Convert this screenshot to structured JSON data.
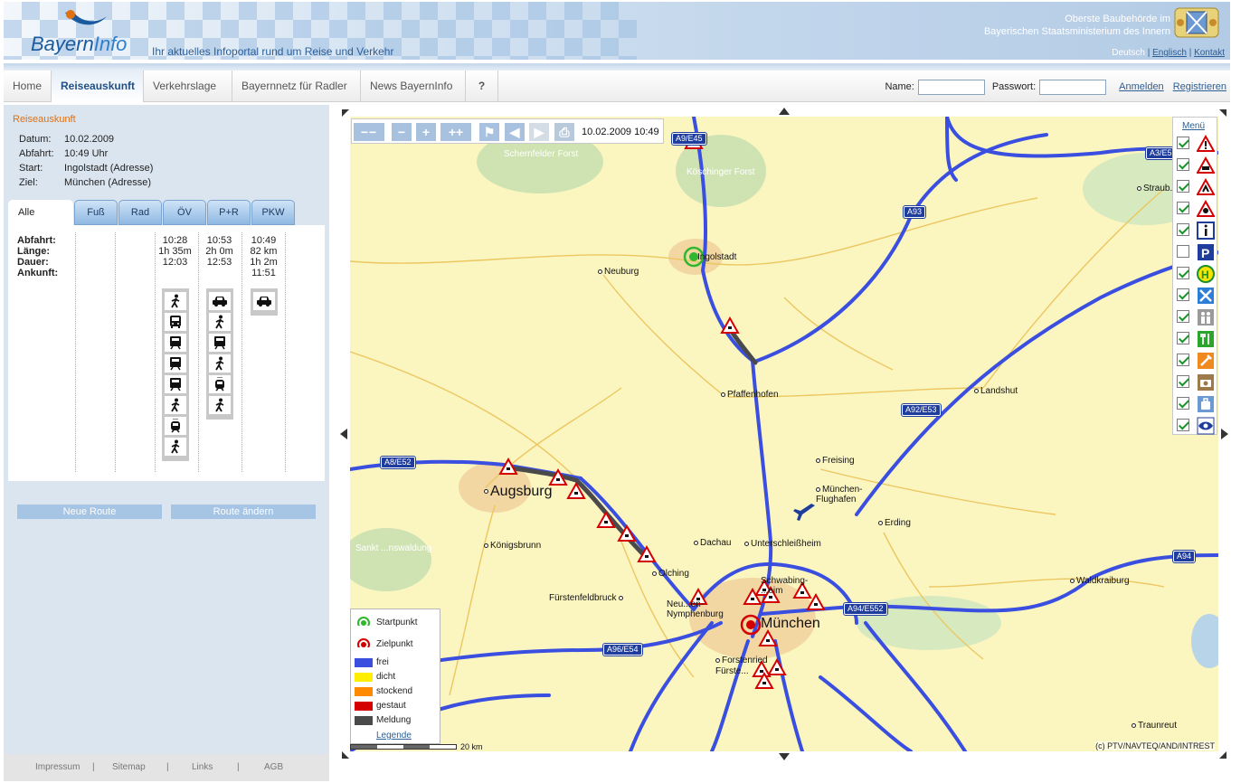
{
  "header": {
    "logo_bayern": "Bayern",
    "logo_info": "Info",
    "tagline": "Ihr aktuelles Infoportal rund um Reise und Verkehr",
    "ministry_line1": "Oberste Baubehörde im",
    "ministry_line2": "Bayerischen Staatsministerium des Innern",
    "lang_current": "Deutsch",
    "lang_english": "Englisch",
    "contact": "Kontakt",
    "sep": "|"
  },
  "nav": {
    "items": [
      "Home",
      "Reiseauskunft",
      "Verkehrslage",
      "Bayernnetz für Radler",
      "News BayernInfo",
      "?"
    ],
    "active": "Reiseauskunft",
    "name_label": "Name:",
    "password_label": "Passwort:",
    "login": "Anmelden",
    "register": "Registrieren"
  },
  "trip": {
    "section_title": "Reiseauskunft",
    "fields": [
      {
        "label": "Datum:",
        "value": "10.02.2009"
      },
      {
        "label": "Abfahrt:",
        "value": "10:49 Uhr"
      },
      {
        "label": "Start:",
        "value": "Ingolstadt (Adresse)"
      },
      {
        "label": "Ziel:",
        "value": "München (Adresse)"
      }
    ],
    "tabs": [
      "Alle",
      "Fuß",
      "Rad",
      "ÖV",
      "P+R",
      "PKW"
    ],
    "active_tab": "Alle",
    "row_labels": [
      "Abfahrt:",
      "Länge:",
      "Dauer:",
      "Ankunft:"
    ],
    "columns": [
      {
        "mode": "ÖV",
        "abfahrt": "10:28",
        "laenge": "",
        "dauer": "1h 35m",
        "ankunft": "12:03",
        "legs": [
          "walk-icon",
          "bus-icon",
          "train-icon",
          "train-icon",
          "train-icon",
          "walk-icon",
          "tram-icon",
          "walk-icon"
        ]
      },
      {
        "mode": "P+R",
        "abfahrt": "10:53",
        "laenge": "",
        "dauer": "2h 0m",
        "ankunft": "12:53",
        "legs": [
          "car-icon",
          "walk-icon",
          "train-icon",
          "walk-icon",
          "tram-icon",
          "walk-icon"
        ]
      },
      {
        "mode": "PKW",
        "abfahrt": "10:49",
        "laenge": "82 km",
        "dauer": "1h 2m",
        "ankunft": "11:51",
        "legs": [
          "car-icon"
        ]
      }
    ],
    "btn_new": "Neue Route",
    "btn_change": "Route ändern"
  },
  "footer": {
    "items": [
      "Impressum",
      "Sitemap",
      "Links",
      "AGB"
    ],
    "sep": "|"
  },
  "map": {
    "toolbar_date": "10.02.2009 10:49",
    "menu_title": "Menü",
    "layers": [
      {
        "icon": "warning-icon",
        "checked": true
      },
      {
        "icon": "accident-icon",
        "checked": true
      },
      {
        "icon": "roadworks-icon",
        "checked": true
      },
      {
        "icon": "hazard-icon",
        "checked": true
      },
      {
        "icon": "info-icon",
        "checked": true
      },
      {
        "icon": "parking-icon",
        "checked": false
      },
      {
        "icon": "bus-stop-icon",
        "checked": true
      },
      {
        "icon": "service-icon",
        "checked": true
      },
      {
        "icon": "people-icon",
        "checked": true
      },
      {
        "icon": "restaurant-icon",
        "checked": true
      },
      {
        "icon": "fuel-icon",
        "checked": true
      },
      {
        "icon": "camera-icon",
        "checked": true
      },
      {
        "icon": "luggage-icon",
        "checked": true
      },
      {
        "icon": "eye-icon",
        "checked": true
      }
    ],
    "legend": [
      {
        "label": "Startpunkt",
        "kind": "start"
      },
      {
        "label": "Zielpunkt",
        "kind": "target"
      },
      {
        "label": "frei",
        "color": "#3a4fe0"
      },
      {
        "label": "dicht",
        "color": "#ffee00"
      },
      {
        "label": "stockend",
        "color": "#ff8a00"
      },
      {
        "label": "gestaut",
        "color": "#d40000"
      },
      {
        "label": "Meldung",
        "color": "#4a4a4a"
      }
    ],
    "legend_link": "Legende",
    "scale": "20 km",
    "copyright": "(c) PTV/NAVTEQ/AND/INTREST",
    "cities": {
      "ingolstadt": "Ingolstadt",
      "neuburg": "Neuburg",
      "pfaffenhofen": "Pfaffenhofen",
      "landshut": "Landshut",
      "freising": "Freising",
      "flughafen": "München-\nFlughafen",
      "erding": "Erding",
      "augsburg": "Augsburg",
      "koenigsbrunn": "Königsbrunn",
      "dachau": "Dachau",
      "unterschleissheim": "Unterschleißheim",
      "olching": "Olching",
      "fuerstenfeldbruck": "Fürstenfeldbruck",
      "neuaubing": "Neu...en-\nNymphenburg",
      "schwabing": "Schwabing-\n...eim",
      "muenchen": "München",
      "forstenried": "Forstenried\nFürste...",
      "waldkraiburg": "Waldkraiburg",
      "traunreut": "Traunreut",
      "straubing": "Straub..."
    },
    "forests": {
      "schernfelder": "Schernfelder\nForst",
      "koeschinger": "Köschinger\nForst",
      "sankt": "Sankt\n...nswaldung"
    },
    "roads": {
      "a9e45": "A9/E45",
      "a3e56": "A3/E5...",
      "a93": "A93",
      "a92e53": "A92/E53",
      "a8e52": "A8/E52",
      "a94": "A94",
      "a94e552": "A94/E552",
      "a96e54": "A96/E54"
    },
    "colors": {
      "road": "#3a4fe0",
      "jam": "#4a4a4a",
      "start": "#2fb82f",
      "target": "#d40000",
      "land": "#fbf5c0"
    }
  }
}
